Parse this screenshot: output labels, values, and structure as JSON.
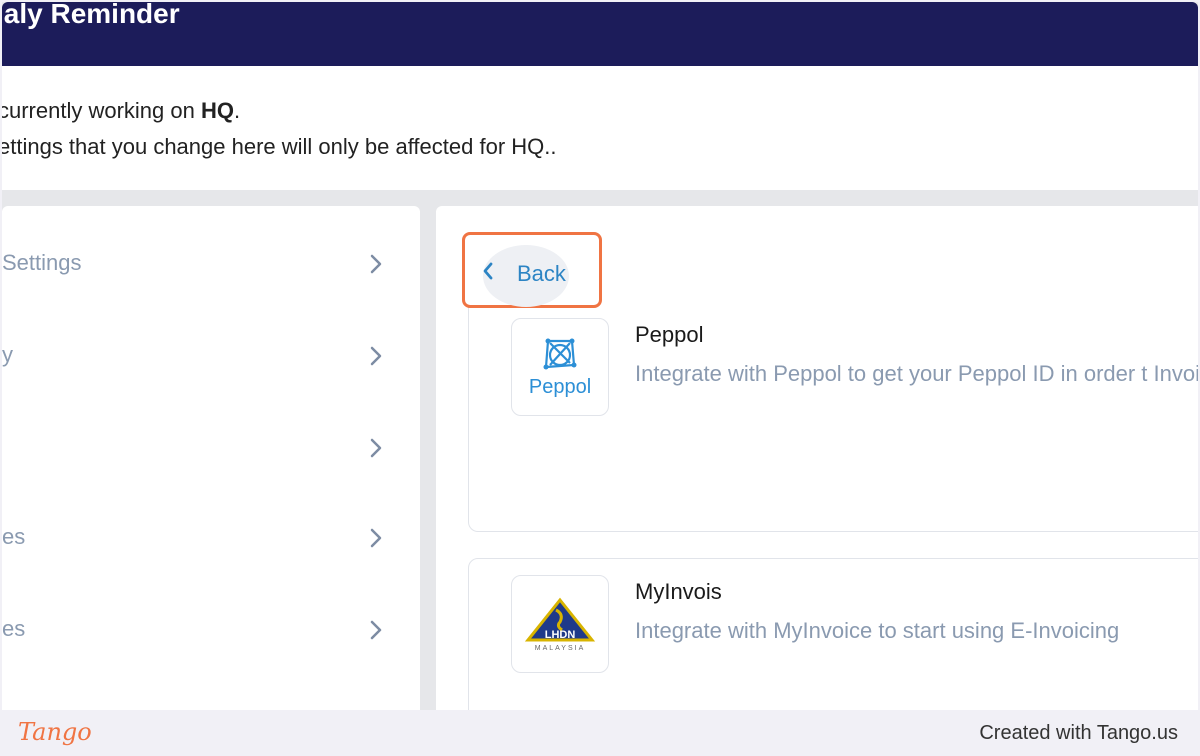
{
  "header": {
    "title": "ialy Reminder"
  },
  "notice": {
    "line1_prefix": "currently working on ",
    "line1_bold": "HQ",
    "line1_suffix": ".",
    "line2": "ettings that you change here will only be affected for HQ.."
  },
  "sidebar": {
    "items": [
      {
        "label": "Settings"
      },
      {
        "label": "y"
      },
      {
        "label": ""
      },
      {
        "label": "es"
      },
      {
        "label": "es"
      }
    ]
  },
  "main": {
    "back_label": "Back",
    "integrations": [
      {
        "name": "Peppol",
        "logo_text": "Peppol",
        "description": "Integrate with Peppol to get your Peppol ID in order t Invoicing"
      },
      {
        "name": "MyInvois",
        "logo_text": "LHDN",
        "logo_subtext": "MALAYSIA",
        "description": "Integrate with MyInvoice to start using E-Invoicing"
      }
    ]
  },
  "footer": {
    "logo": "Tango",
    "credit": "Created with Tango.us"
  },
  "colors": {
    "header_bg": "#1c1c5a",
    "accent_orange": "#f07443",
    "link_blue": "#2c84c4",
    "muted_text": "#8a9ab0"
  }
}
